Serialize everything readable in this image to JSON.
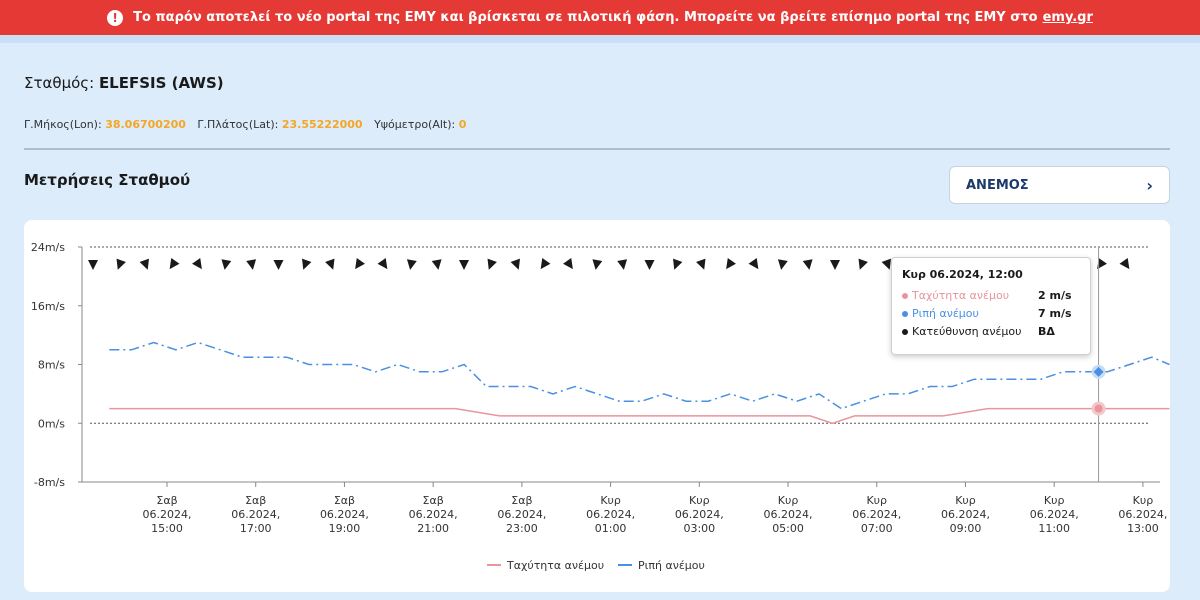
{
  "banner": {
    "icon": "exclamation-icon",
    "text": "Το παρόν αποτελεί το νέο portal της ΕΜΥ και βρίσκεται σε πιλοτική φάση. Μπορείτε να βρείτε επίσημο portal της ΕΜΥ στο",
    "link_text": "emy.gr",
    "bg_color": "#e53935"
  },
  "station": {
    "label": "Σταθμός:",
    "name": "ELEFSIS (AWS)",
    "lon_label": "Γ.Μήκος(Lon):",
    "lon": "38.06700200",
    "lat_label": "Γ.Πλάτος(Lat):",
    "lat": "23.55222000",
    "alt_label": "Υψόμετρο(Alt):",
    "alt": "0"
  },
  "measurements": {
    "title": "Μετρήσεις Σταθμού",
    "select_value": "ΑΝΕΜΟΣ"
  },
  "tooltip": {
    "title": "Κυρ 06.2024, 12:00",
    "rows": [
      {
        "label": "Ταχύτητα ανέμου",
        "value": "2 m/s"
      },
      {
        "label": "Ριπή ανέμου",
        "value": "7 m/s"
      },
      {
        "label": "Κατεύθυνση ανέμου",
        "value": "ΒΔ"
      }
    ]
  },
  "chart_data": {
    "type": "line",
    "y_ticks": [
      "24m/s",
      "16m/s",
      "8m/s",
      "0m/s",
      "-8m/s"
    ],
    "y_tick_values": [
      24,
      16,
      8,
      0,
      -8
    ],
    "ylim": [
      -8,
      24
    ],
    "x_start_hour": 13.7,
    "x_end_hour": 13.6,
    "x_ticks": [
      {
        "hour": 15,
        "l1": "Σαβ",
        "l2": "06.2024,",
        "l3": "15:00"
      },
      {
        "hour": 17,
        "l1": "Σαβ",
        "l2": "06.2024,",
        "l3": "17:00"
      },
      {
        "hour": 19,
        "l1": "Σαβ",
        "l2": "06.2024,",
        "l3": "19:00"
      },
      {
        "hour": 21,
        "l1": "Σαβ",
        "l2": "06.2024,",
        "l3": "21:00"
      },
      {
        "hour": 23,
        "l1": "Σαβ",
        "l2": "06.2024,",
        "l3": "23:00"
      },
      {
        "hour": 25,
        "l1": "Κυρ",
        "l2": "06.2024,",
        "l3": "01:00"
      },
      {
        "hour": 27,
        "l1": "Κυρ",
        "l2": "06.2024,",
        "l3": "03:00"
      },
      {
        "hour": 29,
        "l1": "Κυρ",
        "l2": "06.2024,",
        "l3": "05:00"
      },
      {
        "hour": 31,
        "l1": "Κυρ",
        "l2": "06.2024,",
        "l3": "07:00"
      },
      {
        "hour": 33,
        "l1": "Κυρ",
        "l2": "06.2024,",
        "l3": "09:00"
      },
      {
        "hour": 35,
        "l1": "Κυρ",
        "l2": "06.2024,",
        "l3": "11:00"
      },
      {
        "hour": 37,
        "l1": "Κυρ",
        "l2": "06.2024,",
        "l3": "13:00"
      }
    ],
    "series": [
      {
        "name": "Ταχύτητα ανέμου",
        "color": "#e8959c",
        "x": [
          13.7,
          14.5,
          15.5,
          16.5,
          17.5,
          18.5,
          19.5,
          20.5,
          21.5,
          22.5,
          23.5,
          24.5,
          25.5,
          26.5,
          27.5,
          28.5,
          29.5,
          30.0,
          30.5,
          31.5,
          32.5,
          33.5,
          34.5,
          35.5,
          36.0,
          37.0,
          37.6
        ],
        "values": [
          2,
          2,
          2,
          2,
          2,
          2,
          2,
          2,
          2,
          1,
          1,
          1,
          1,
          1,
          1,
          1,
          1,
          0,
          1,
          1,
          1,
          2,
          2,
          2,
          2,
          2,
          2
        ]
      },
      {
        "name": "Ριπή ανέμου",
        "color": "#4a90e2",
        "x": [
          13.7,
          14.2,
          14.7,
          15.2,
          15.7,
          16.2,
          16.7,
          17.2,
          17.7,
          18.2,
          18.7,
          19.2,
          19.7,
          20.2,
          20.7,
          21.2,
          21.7,
          22.2,
          22.7,
          23.2,
          23.7,
          24.2,
          24.7,
          25.2,
          25.7,
          26.2,
          26.7,
          27.2,
          27.7,
          28.2,
          28.7,
          29.2,
          29.7,
          30.2,
          30.7,
          31.2,
          31.7,
          32.2,
          32.7,
          33.2,
          33.7,
          34.2,
          34.7,
          35.2,
          35.7,
          36.2,
          36.7,
          37.2,
          37.6
        ],
        "values": [
          10,
          10,
          11,
          10,
          11,
          10,
          9,
          9,
          9,
          8,
          8,
          8,
          7,
          8,
          7,
          7,
          8,
          5,
          5,
          5,
          4,
          5,
          4,
          3,
          3,
          4,
          3,
          3,
          4,
          3,
          4,
          3,
          4,
          2,
          3,
          4,
          4,
          5,
          5,
          6,
          6,
          6,
          6,
          7,
          7,
          7,
          8,
          9,
          8
        ]
      }
    ],
    "direction_markers": 40,
    "highlight": {
      "hour": 36.0,
      "speed": 2,
      "gust": 7
    }
  }
}
